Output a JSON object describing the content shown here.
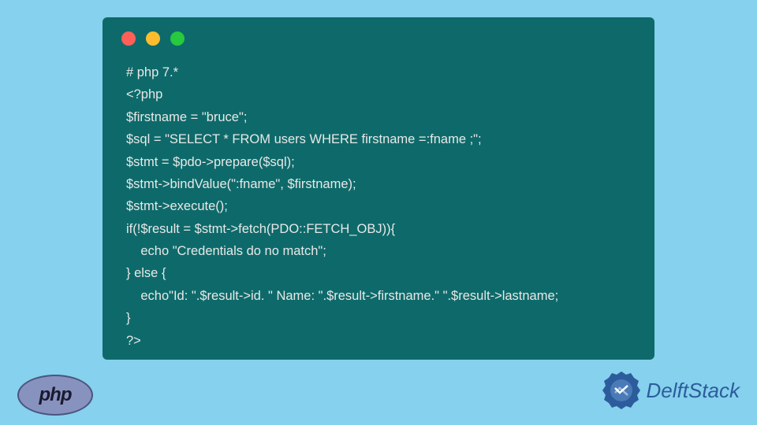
{
  "code": {
    "lines": [
      "# php 7.*",
      "<?php",
      "$firstname = \"bruce\";",
      "$sql = \"SELECT * FROM users WHERE firstname =:fname ;\";",
      "$stmt = $pdo->prepare($sql);",
      "$stmt->bindValue(\":fname\", $firstname);",
      "$stmt->execute();",
      "if(!$result = $stmt->fetch(PDO::FETCH_OBJ)){",
      "    echo \"Credentials do no match\";",
      "} else {",
      "    echo\"Id: \".$result->id. \" Name: \".$result->firstname.\" \".$result->lastname;",
      "}",
      "?>"
    ]
  },
  "logos": {
    "php": "php",
    "delftstack": "DelftStack"
  }
}
